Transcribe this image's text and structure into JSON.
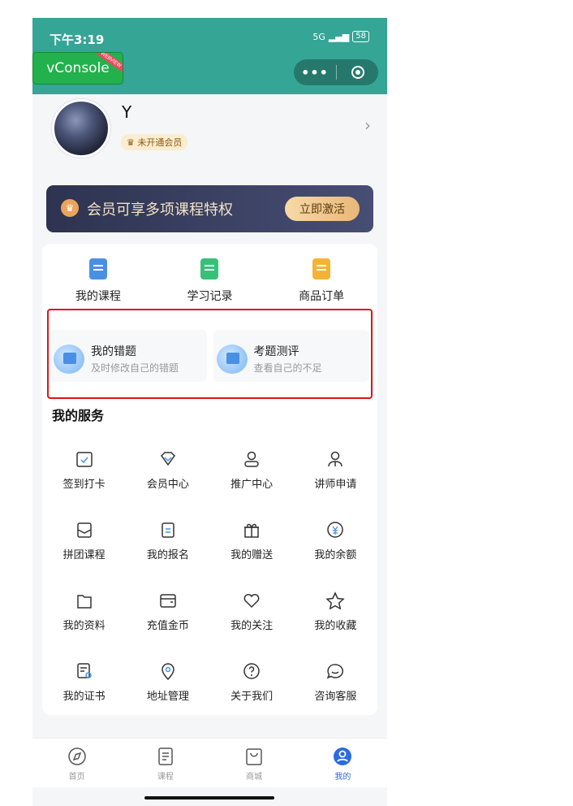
{
  "status_bar": {
    "time": "下午3:19",
    "network": "5G",
    "battery": "58"
  },
  "vconsole": {
    "label": "vConsole",
    "ribbon": "WEBVIEW"
  },
  "capsule": {
    "more": "•••"
  },
  "profile": {
    "name": "Y",
    "vip_badge": "未开通会员"
  },
  "banner": {
    "text": "会员可享多项课程特权",
    "button": "立即激活",
    "icon": "crown-icon"
  },
  "quick_links": [
    {
      "label": "我的课程",
      "color": "#4a90e2"
    },
    {
      "label": "学习记录",
      "color": "#37c178"
    },
    {
      "label": "商品订单",
      "color": "#f5b335"
    }
  ],
  "tools": [
    {
      "title": "我的错题",
      "subtitle": "及时修改自己的错题"
    },
    {
      "title": "考题测评",
      "subtitle": "查看自己的不足"
    }
  ],
  "services": {
    "title": "我的服务",
    "items": [
      {
        "label": "签到打卡",
        "icon": "calendar-check-icon"
      },
      {
        "label": "会员中心",
        "icon": "diamond-icon"
      },
      {
        "label": "推广中心",
        "icon": "user-icon"
      },
      {
        "label": "讲师申请",
        "icon": "lecturer-icon"
      },
      {
        "label": "拼团课程",
        "icon": "group-course-icon"
      },
      {
        "label": "我的报名",
        "icon": "clipboard-icon"
      },
      {
        "label": "我的赠送",
        "icon": "gift-icon"
      },
      {
        "label": "我的余额",
        "icon": "yen-icon"
      },
      {
        "label": "我的资料",
        "icon": "folder-icon"
      },
      {
        "label": "充值金币",
        "icon": "wallet-icon"
      },
      {
        "label": "我的关注",
        "icon": "heart-icon"
      },
      {
        "label": "我的收藏",
        "icon": "star-icon"
      },
      {
        "label": "我的证书",
        "icon": "certificate-icon"
      },
      {
        "label": "地址管理",
        "icon": "location-icon"
      },
      {
        "label": "关于我们",
        "icon": "question-icon"
      },
      {
        "label": "咨询客服",
        "icon": "chat-icon"
      }
    ]
  },
  "tabbar": [
    {
      "label": "首页",
      "icon": "compass-icon"
    },
    {
      "label": "课程",
      "icon": "document-icon"
    },
    {
      "label": "商城",
      "icon": "bag-icon"
    },
    {
      "label": "我的",
      "icon": "profile-icon",
      "active": true
    }
  ],
  "colors": {
    "header": "#35a596",
    "accent": "#2c6be0",
    "highlight": "#e01313"
  }
}
